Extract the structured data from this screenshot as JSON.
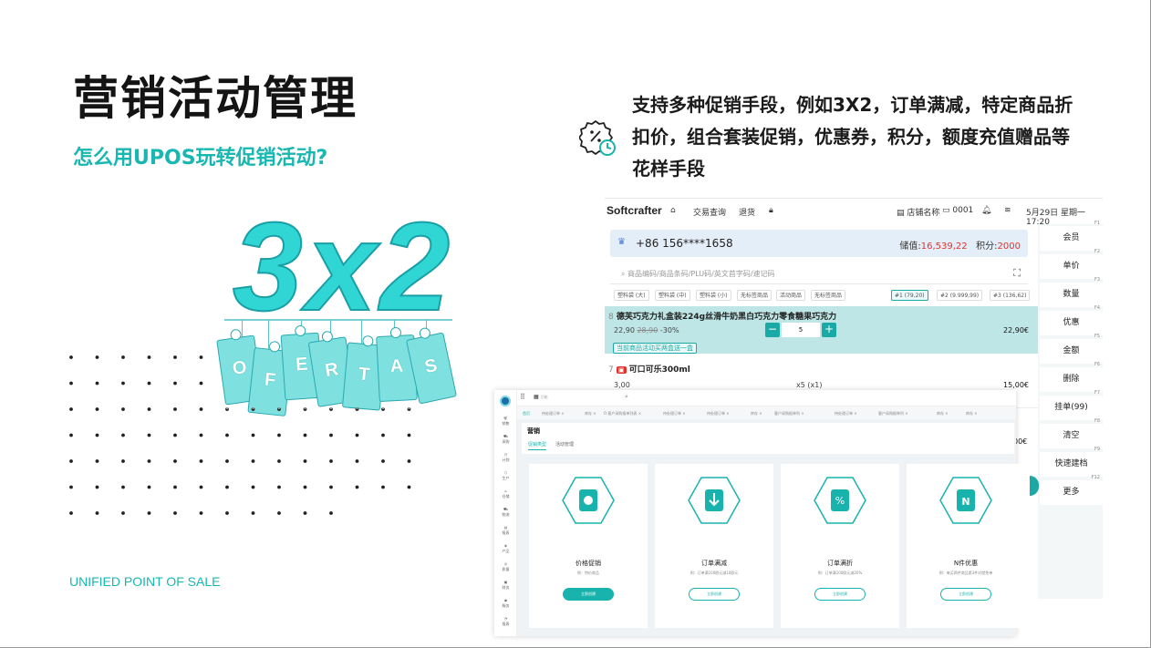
{
  "page": {
    "title": "营销活动管理",
    "subtitle": "怎么用UPOS玩转促销活动?",
    "footer_brand": "UNIFIED POINT OF SALE",
    "hero_big": "3x2",
    "hero_tags": [
      "O",
      "F",
      "E",
      "R",
      "T",
      "A",
      "S"
    ],
    "description": "支持多种促销手段，例如3X2，订单满减，特定商品折扣价，组合套装促销，优惠券，积分，额度充值赠品等花样手段",
    "accent": "#18b7b1"
  },
  "pos": {
    "logo": "Softcrafter",
    "nav": [
      "交易查询",
      "退货"
    ],
    "store": "店铺名称",
    "terminal": "0001",
    "datetime": "5月29日 星期一 17:20",
    "member_phone": "+86 156****1658",
    "balance_label": "储值:",
    "balance_value": "16,539,22",
    "points_label": "积分:",
    "points_value": "2000",
    "search_placeholder": "商品编码/商品条码/PLU码/英文首字码/速记码",
    "chips": [
      "塑料袋 (大)",
      "塑料袋 (中)",
      "塑料袋 (小)",
      "无标签商品",
      "活动商品",
      "无标签商品"
    ],
    "held_chips": [
      "#1 (79,20)",
      "#2 (9.999,99)",
      "#3 (136,62)"
    ],
    "items": [
      {
        "index": "8",
        "name": "德芙巧克力礼盒装224g丝滑牛奶黑白巧克力零食糖果巧克力",
        "price": "22,90",
        "orig": "28,90",
        "discount": "-30%",
        "qty": "5",
        "total": "22,90€",
        "promo": "当前商品活动买两盒送一盒"
      },
      {
        "index": "7",
        "name": "可口可乐300ml",
        "price": "3,00",
        "qty_text": "x5 (x1)",
        "total": "15,00€"
      }
    ],
    "cut_total": "00€",
    "function_keys": [
      {
        "key": "F1",
        "label": "会员"
      },
      {
        "key": "F2",
        "label": "单价"
      },
      {
        "key": "F3",
        "label": "数量"
      },
      {
        "key": "F4",
        "label": "优惠"
      },
      {
        "key": "F5",
        "label": "金额"
      },
      {
        "key": "F6",
        "label": "删除"
      },
      {
        "key": "F7",
        "label": "挂单(99)"
      },
      {
        "key": "F8",
        "label": "清空"
      },
      {
        "key": "F9",
        "label": "快速建档"
      },
      {
        "key": "F12",
        "label": "更多"
      }
    ]
  },
  "admin": {
    "search_placeholder": "功能",
    "rail": [
      "销售",
      "采购",
      "计划",
      "生产",
      "仓储",
      "物流",
      "报表",
      "产品",
      "质量",
      "财务",
      "服务",
      "报表"
    ],
    "tabs": [
      "首页",
      "待处理订单 ×",
      "库存 ×",
      "O 客户采购报单列表 ×",
      "待处理订单 ×",
      "待处理订单 ×",
      "库存 ×",
      "客户采购报单列 ×",
      "待处理订单 ×",
      "客户采购报单列 ×",
      "库存 ×",
      "库存 ×"
    ],
    "section": "营销",
    "subtabs": [
      "促销类型",
      "活动管理"
    ],
    "cards": [
      {
        "title": "价格促销",
        "desc": "例：特价商品",
        "button": "立即创建",
        "icon": "price-tag-icon"
      },
      {
        "title": "订单满减",
        "desc": "例：订单满100欧元减10欧元",
        "button": "立即创建",
        "icon": "arrow-down-icon"
      },
      {
        "title": "订单满折",
        "desc": "例：订单满100欧元减20%",
        "button": "立即创建",
        "icon": "percent-icon"
      },
      {
        "title": "N件优惠",
        "desc": "例：每买两件商品第3件对就免单",
        "button": "立即创建",
        "icon": "n-items-icon"
      }
    ]
  }
}
